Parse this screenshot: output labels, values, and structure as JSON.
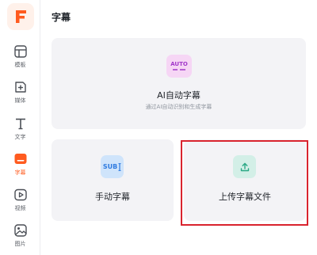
{
  "sidebar": {
    "logo_letter": "F",
    "items": [
      {
        "label": "模板",
        "icon": "template-icon"
      },
      {
        "label": "媒体",
        "icon": "media-icon"
      },
      {
        "label": "文字",
        "icon": "text-icon"
      },
      {
        "label": "字幕",
        "icon": "subtitle-icon",
        "active": true
      },
      {
        "label": "视频",
        "icon": "video-icon"
      },
      {
        "label": "图片",
        "icon": "image-icon"
      }
    ]
  },
  "main": {
    "title": "字幕",
    "auto_card": {
      "badge": "AUTO",
      "title": "AI自动字幕",
      "subtitle": "通过AI自动识别和生成字幕"
    },
    "manual_card": {
      "badge": "SUB",
      "title": "手动字幕"
    },
    "upload_card": {
      "title": "上传字幕文件"
    }
  },
  "colors": {
    "accent": "#ff5b1f",
    "highlight": "#d9232e",
    "card_bg": "#f3f3f6"
  }
}
